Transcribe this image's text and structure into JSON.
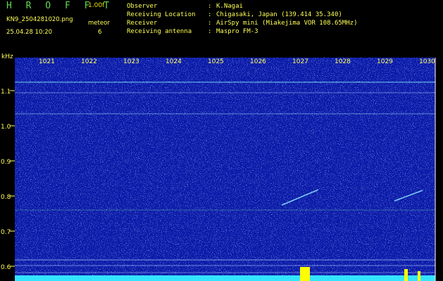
{
  "header": {
    "title": "H R O F F T",
    "version": "1.00f",
    "filename": "KN9_2504281020.png",
    "datetime": "25.04.28 10:20",
    "meteor_label": "meteor",
    "meteor_count": "6"
  },
  "info": [
    {
      "label": "Observer",
      "sep": ":",
      "value": "K.Nagai"
    },
    {
      "label": "Receiving Location",
      "sep": ":",
      "value": "Chigasaki, Japan (139.414 35.340)"
    },
    {
      "label": "Receiver",
      "sep": ":",
      "value": "AirSpy mini (Miakejima VOR 108.65MHz)"
    },
    {
      "label": "Receiving antenna",
      "sep": ":",
      "value": "Maspro FM-3"
    }
  ],
  "axes": {
    "y_unit": "kHz",
    "y_ticks": [
      "1.1",
      "1.0",
      "0.9",
      "0.8",
      "0.7",
      "0.6"
    ],
    "x_ticks": [
      "1021",
      "1022",
      "1023",
      "1024",
      "1025",
      "1026",
      "1027",
      "1028",
      "1029",
      "1030"
    ]
  },
  "colors": {
    "background": "#000000",
    "spectrogram": "#0b1aa8",
    "header_text": "#ffff55",
    "title": "#62d94d",
    "trace": "#33e4ff",
    "burst": "#ffff00"
  }
}
